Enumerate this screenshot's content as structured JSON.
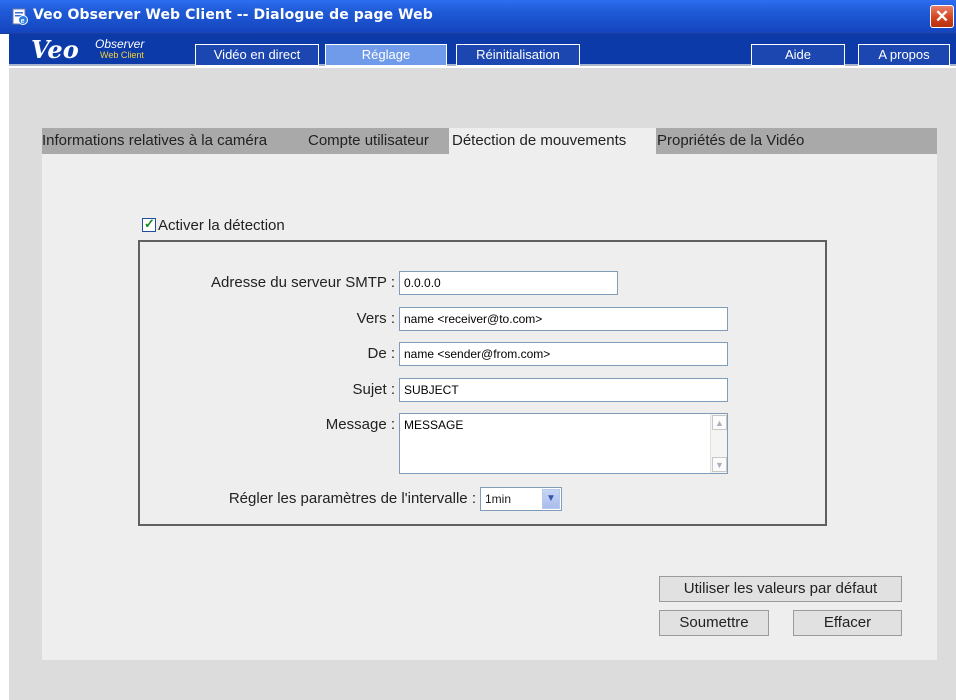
{
  "window": {
    "title": "Veo Observer Web Client -- Dialogue de page Web",
    "close_glyph": "✕"
  },
  "logo": {
    "brand": "Veo",
    "product": "Observer",
    "tagline": "Web Client"
  },
  "nav": {
    "live": "Vidéo en direct",
    "settings": "Réglage",
    "reset": "Réinitialisation",
    "help": "Aide",
    "about": "A propos"
  },
  "tabs": {
    "camera_info": "Informations relatives à la caméra",
    "user_account": "Compte utilisateur",
    "motion_detection": "Détection de mouvements",
    "video_properties": "Propriétés de la Vidéo"
  },
  "form": {
    "enable_detection": {
      "label": "Activer la détection",
      "checked": true
    },
    "smtp": {
      "label": "Adresse du serveur SMTP :",
      "value": "0.0.0.0"
    },
    "to": {
      "label": "Vers :",
      "value": "name <receiver@to.com>"
    },
    "from": {
      "label": "De :",
      "value": "name <sender@from.com>"
    },
    "subject": {
      "label": "Sujet :",
      "value": "SUBJECT"
    },
    "message": {
      "label": "Message :",
      "value": "MESSAGE"
    },
    "interval": {
      "label": "Régler les paramètres de l'intervalle :",
      "value": "1min"
    }
  },
  "buttons": {
    "defaults": "Utiliser les valeurs par défaut",
    "submit": "Soumettre",
    "clear": "Effacer"
  },
  "colors": {
    "titlebar": "#1f5ad6",
    "header": "#0c3aa8",
    "active_nav": "#6f9bea",
    "content_bg": "#dcdcdc",
    "panel_bg": "#eeeeee",
    "tab_bg": "#a9a9a9"
  },
  "icons": {
    "window_icon": "ie-page-icon",
    "close": "close-icon",
    "checkbox": "checkmark-icon",
    "scroll_up": "arrow-up-icon",
    "scroll_down": "arrow-down-icon",
    "dropdown": "chevron-down-icon"
  }
}
